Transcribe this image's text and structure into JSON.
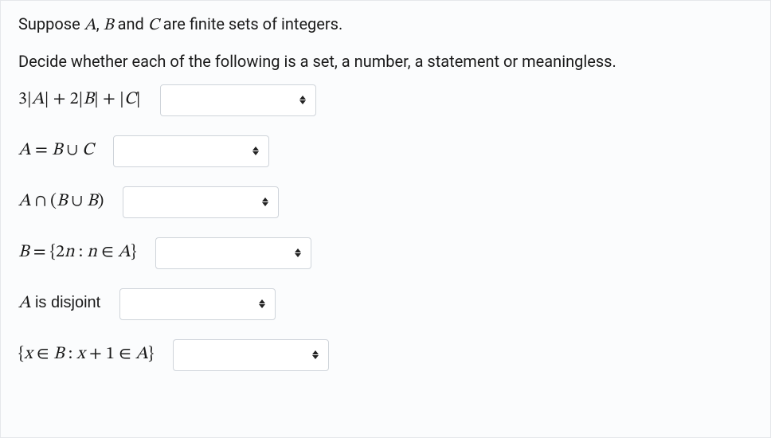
{
  "intro": {
    "line1_pre": "Suppose ",
    "A": "A",
    "comma": ", ",
    "B": "B",
    "and": " and ",
    "C": "C",
    "line1_post": "  are finite sets of integers.",
    "line2": "Decide whether each of the following is a set, a number, a statement or meaningless."
  },
  "rows": [
    {
      "expr_html": "3|<span class='it'>A</span>| + 2|<span class='it'>B</span>| + |<span class='it'>C</span>|",
      "dropdown_width": 196,
      "selected": ""
    },
    {
      "expr_html": "<span class='it'>A</span> = <span class='it'>B</span> ∪ <span class='it'>C</span>",
      "dropdown_width": 196,
      "selected": ""
    },
    {
      "expr_html": "<span class='it'>A</span> ∩ (<span class='it'>B</span> ∪ <span class='it'>B</span>)",
      "dropdown_width": 196,
      "selected": ""
    },
    {
      "expr_html": "<span class='it'>B</span> = {2<span class='it'>n</span> : <span class='it'>n</span> ∈ <span class='it'>A</span>}",
      "dropdown_width": 196,
      "selected": ""
    },
    {
      "expr_html": "<span class='it'>A</span> <span style='font-family:-apple-system,Segoe UI,Arial,sans-serif;font-size:20px;font-style:normal'>is disjoint</span>",
      "dropdown_width": 196,
      "selected": ""
    },
    {
      "expr_html": "{<span class='it'>x</span> ∈ <span class='it'>B</span> : <span class='it'>x</span> + 1 ∈ <span class='it'>A</span>}",
      "dropdown_width": 196,
      "selected": ""
    }
  ]
}
